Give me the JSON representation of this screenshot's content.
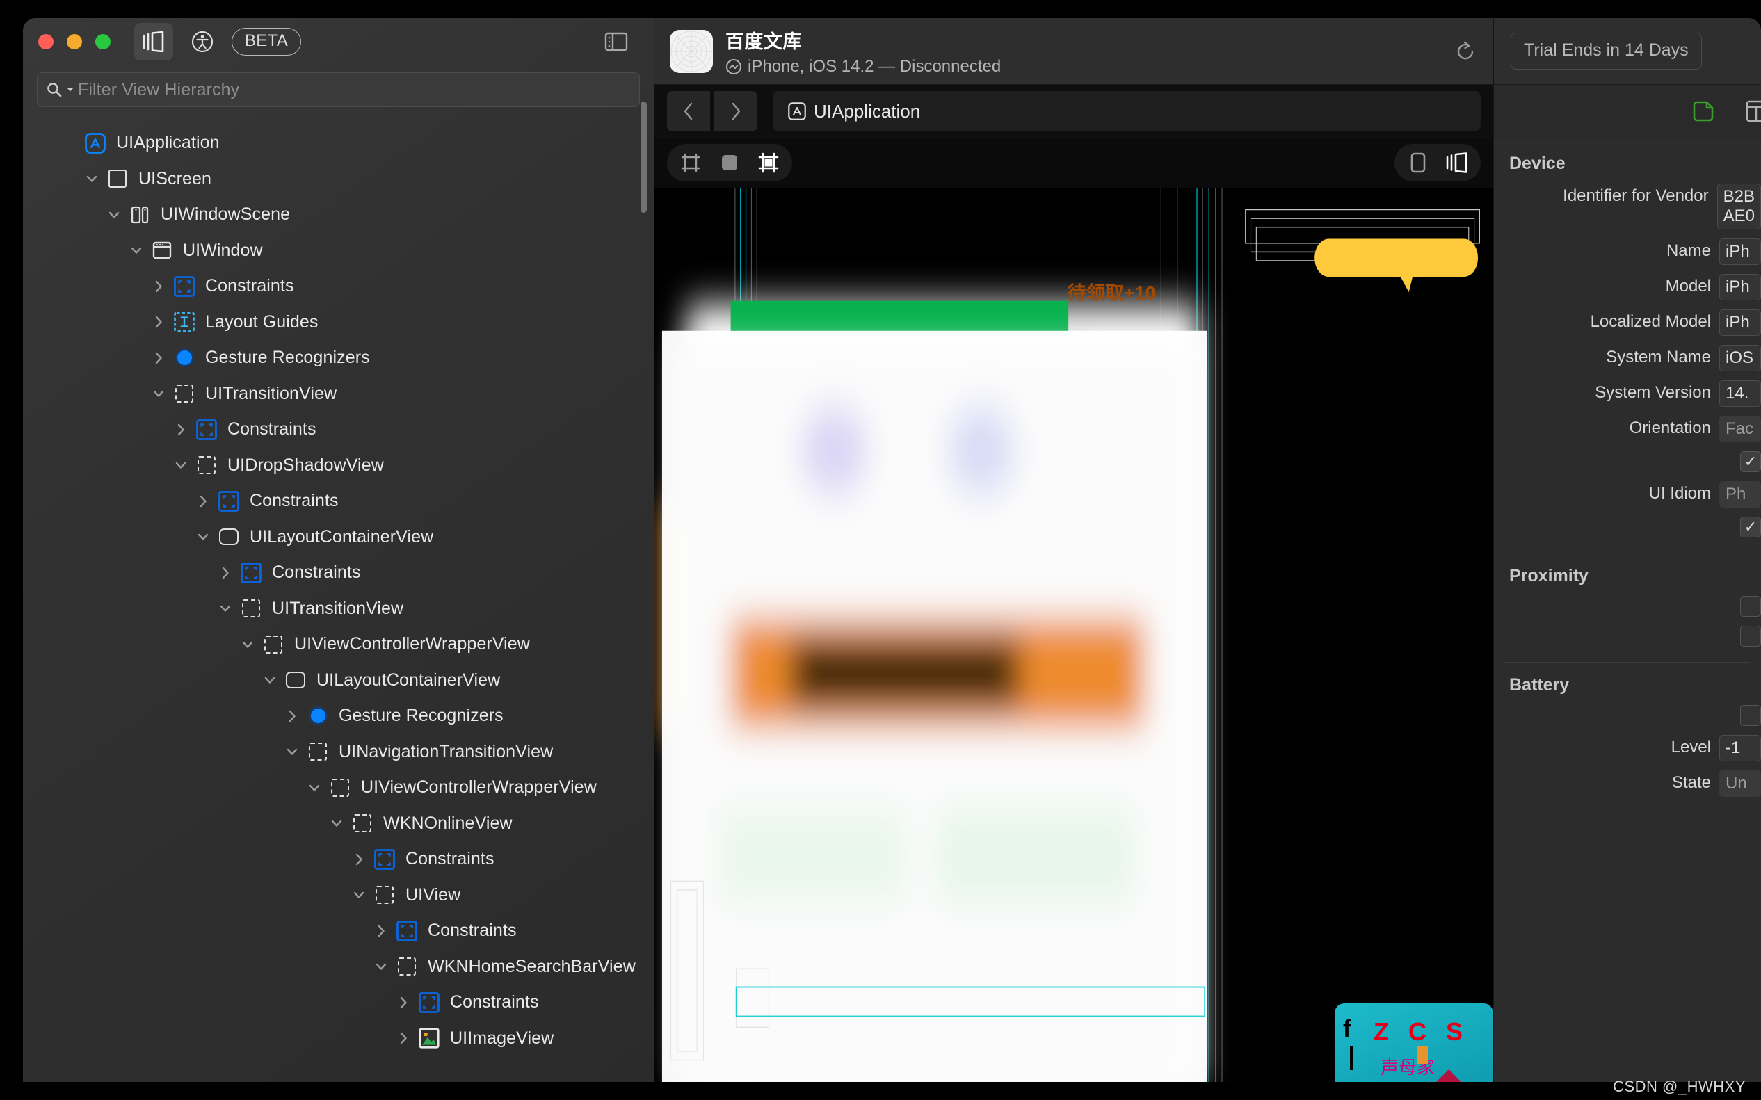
{
  "window": {
    "traffic_lights": [
      "close",
      "minimize",
      "zoom"
    ],
    "sidebar_toggle_icon": "sidebar-layout-icon",
    "accessibility_icon": "accessibility-icon",
    "beta_label": "BETA",
    "right_panel_toggle_icon": "panel-toggle-icon"
  },
  "search": {
    "placeholder": "Filter View Hierarchy",
    "icon": "search-icon"
  },
  "tree": {
    "items": [
      {
        "label": "UIApplication",
        "depth": 0,
        "twist": "none",
        "icon": "app-store-icon"
      },
      {
        "label": "UIScreen",
        "depth": 1,
        "twist": "down",
        "icon": "square-icon"
      },
      {
        "label": "UIWindowScene",
        "depth": 2,
        "twist": "down",
        "icon": "window-scene-icon"
      },
      {
        "label": "UIWindow",
        "depth": 3,
        "twist": "down",
        "icon": "window-icon"
      },
      {
        "label": "Constraints",
        "depth": 4,
        "twist": "right",
        "icon": "constraints-icon"
      },
      {
        "label": "Layout Guides",
        "depth": 4,
        "twist": "right",
        "icon": "layout-guides-icon"
      },
      {
        "label": "Gesture Recognizers",
        "depth": 4,
        "twist": "right",
        "icon": "gesture-icon"
      },
      {
        "label": "UITransitionView",
        "depth": 4,
        "twist": "down",
        "icon": "dashed-square-icon"
      },
      {
        "label": "Constraints",
        "depth": 5,
        "twist": "right",
        "icon": "constraints-icon"
      },
      {
        "label": "UIDropShadowView",
        "depth": 5,
        "twist": "down",
        "icon": "dashed-square-icon"
      },
      {
        "label": "Constraints",
        "depth": 6,
        "twist": "right",
        "icon": "constraints-icon"
      },
      {
        "label": "UILayoutContainerView",
        "depth": 6,
        "twist": "down",
        "icon": "rounded-square-icon"
      },
      {
        "label": "Constraints",
        "depth": 7,
        "twist": "right",
        "icon": "constraints-icon"
      },
      {
        "label": "UITransitionView",
        "depth": 7,
        "twist": "down",
        "icon": "dashed-square-icon"
      },
      {
        "label": "UIViewControllerWrapperView",
        "depth": 8,
        "twist": "down",
        "icon": "dashed-square-icon"
      },
      {
        "label": "UILayoutContainerView",
        "depth": 9,
        "twist": "down",
        "icon": "rounded-square-icon"
      },
      {
        "label": "Gesture Recognizers",
        "depth": 10,
        "twist": "right",
        "icon": "gesture-icon"
      },
      {
        "label": "UINavigationTransitionView",
        "depth": 10,
        "twist": "down",
        "icon": "dashed-square-icon"
      },
      {
        "label": "UIViewControllerWrapperView",
        "depth": 11,
        "twist": "down",
        "icon": "dashed-square-icon"
      },
      {
        "label": "WKNOnlineView",
        "depth": 12,
        "twist": "down",
        "icon": "dashed-square-icon"
      },
      {
        "label": "Constraints",
        "depth": 13,
        "twist": "right",
        "icon": "constraints-icon"
      },
      {
        "label": "UIView",
        "depth": 13,
        "twist": "down",
        "icon": "dashed-square-icon"
      },
      {
        "label": "Constraints",
        "depth": 14,
        "twist": "right",
        "icon": "constraints-icon"
      },
      {
        "label": "WKNHomeSearchBarView",
        "depth": 14,
        "twist": "down",
        "icon": "dashed-square-icon"
      },
      {
        "label": "Constraints",
        "depth": 15,
        "twist": "right",
        "icon": "constraints-icon"
      },
      {
        "label": "UIImageView",
        "depth": 15,
        "twist": "right",
        "icon": "image-icon"
      }
    ]
  },
  "device_header": {
    "app_name": "百度文库",
    "status_line": "iPhone, iOS 14.2 — Disconnected",
    "status_icon": "connection-status-icon",
    "app_icon": "baidu-wenku-app-icon",
    "refresh_icon": "refresh-icon"
  },
  "navbar": {
    "back_icon": "chevron-left-icon",
    "forward_icon": "chevron-right-icon",
    "breadcrumb_label": "UIApplication",
    "breadcrumb_icon": "app-store-icon"
  },
  "canvas_toolbar": {
    "left_segments": [
      {
        "name": "wireframe-mode",
        "icon": "frame-outline-icon",
        "active": false
      },
      {
        "name": "contents-mode",
        "icon": "filled-square-icon",
        "active": false
      },
      {
        "name": "wireframe-and-contents-mode",
        "icon": "frame-filled-icon",
        "active": true
      }
    ],
    "right_segments": [
      {
        "name": "single-view-mode",
        "icon": "single-panel-icon",
        "active": false
      },
      {
        "name": "split-view-mode",
        "icon": "split-panel-icon",
        "active": true
      }
    ]
  },
  "canvas": {
    "badge_label": "待领取+10",
    "badge_bg": "#ffc93c",
    "badge_text_color": "#a34a00",
    "green_bar_color": "#07b24e",
    "promo_text_primary": "Z C S",
    "promo_text_secondary": "声母家",
    "promo_bg": "#17b3c4",
    "promo_primary_color": "#e3001b",
    "promo_secondary_color": "#d6007f",
    "highlight_color": "#00c8d7"
  },
  "inspector": {
    "trial_label": "Trial Ends in 14 Days",
    "tabs": [
      {
        "name": "object-inspector-tab",
        "icon": "file-object-icon",
        "color": "#3a9e2a",
        "active": true
      },
      {
        "name": "layout-inspector-tab",
        "icon": "panel-grid-icon",
        "color": "#b0b0b0",
        "active": false
      }
    ],
    "sections": [
      {
        "title": "Device",
        "rows": [
          {
            "label": "Identifier for Vendor",
            "value": "B2B\nAE0",
            "kind": "field"
          },
          {
            "label": "Name",
            "value": "iPh",
            "kind": "field"
          },
          {
            "label": "Model",
            "value": "iPh",
            "kind": "field"
          },
          {
            "label": "Localized Model",
            "value": "iPh",
            "kind": "field"
          },
          {
            "label": "System Name",
            "value": "iOS",
            "kind": "field"
          },
          {
            "label": "System Version",
            "value": "14.",
            "kind": "field"
          },
          {
            "label": "Orientation",
            "value": "Fac",
            "kind": "flat"
          },
          {
            "label": "",
            "value": "",
            "kind": "checkbox-checked"
          },
          {
            "label": "UI Idiom",
            "value": "Ph",
            "kind": "flat"
          },
          {
            "label": "",
            "value": "",
            "kind": "checkbox-checked"
          }
        ]
      },
      {
        "title": "Proximity",
        "rows": [
          {
            "label": "",
            "value": "",
            "kind": "checkbox-empty"
          },
          {
            "label": "",
            "value": "",
            "kind": "checkbox-empty"
          }
        ]
      },
      {
        "title": "Battery",
        "rows": [
          {
            "label": "",
            "value": "",
            "kind": "checkbox-empty"
          },
          {
            "label": "Level",
            "value": "-1",
            "kind": "field"
          },
          {
            "label": "State",
            "value": "Un",
            "kind": "flat"
          }
        ]
      }
    ]
  },
  "watermark": {
    "text": "CSDN @_HWHXY"
  }
}
